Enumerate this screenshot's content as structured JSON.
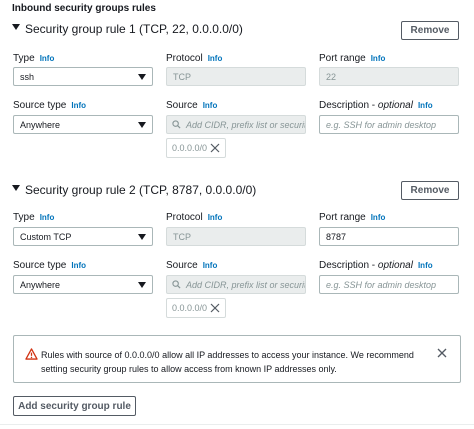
{
  "section_title": "Inbound security groups rules",
  "info_label": "Info",
  "remove_label": "Remove",
  "rules": [
    {
      "title": "Security group rule 1 (TCP, 22, 0.0.0.0/0)",
      "type_label": "Type",
      "type_value": "ssh",
      "protocol_label": "Protocol",
      "protocol_value": "TCP",
      "port_label": "Port range",
      "port_value": "22",
      "source_type_label": "Source type",
      "source_type_value": "Anywhere",
      "source_label": "Source",
      "source_placeholder": "Add CIDR, prefix list or security",
      "source_token": "0.0.0.0/0",
      "description_label": "Description",
      "description_optional": "optional",
      "description_placeholder": "e.g. SSH for admin desktop"
    },
    {
      "title": "Security group rule 2 (TCP, 8787, 0.0.0.0/0)",
      "type_label": "Type",
      "type_value": "Custom TCP",
      "protocol_label": "Protocol",
      "protocol_value": "TCP",
      "port_label": "Port range",
      "port_value": "8787",
      "source_type_label": "Source type",
      "source_type_value": "Anywhere",
      "source_label": "Source",
      "source_placeholder": "Add CIDR, prefix list or security",
      "source_token": "0.0.0.0/0",
      "description_label": "Description",
      "description_optional": "optional",
      "description_placeholder": "e.g. SSH for admin desktop"
    }
  ],
  "alert": {
    "text": "Rules with source of 0.0.0.0/0 allow all IP addresses to access your instance. We recommend setting security group rules to allow access from known IP addresses only.",
    "icon": "warning-icon"
  },
  "add_rule_label": "Add security group rule",
  "colors": {
    "link": "#0073bb",
    "warning": "#d13212",
    "border": "#aab7b8",
    "disabled_bg": "#eaeded"
  }
}
